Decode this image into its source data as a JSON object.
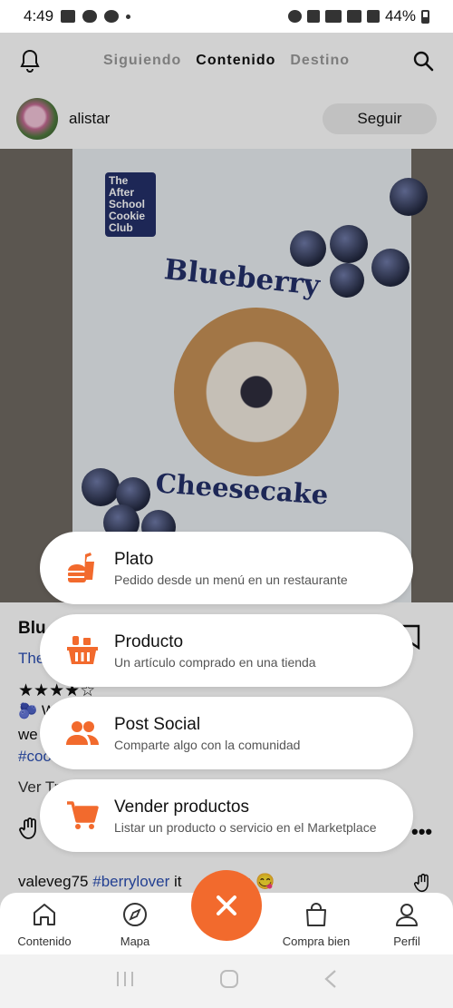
{
  "status": {
    "time": "4:49",
    "battery": "44%"
  },
  "header": {
    "tabs": [
      "Siguiendo",
      "Contenido",
      "Destino"
    ],
    "active_tab": 1
  },
  "post": {
    "username": "alistar",
    "follow_label": "Seguir",
    "poster": {
      "brand": "The After School Cookie Club",
      "title_top": "Blueberry",
      "title_bottom": "Cheesecake"
    },
    "title_fragment": "Blu",
    "link_fragment": "The",
    "stars": "★★★★☆",
    "text_fragment_1": "🫐 W",
    "text_fragment_2": "we",
    "hashtag_fragment": "#coo",
    "translate_fragment": "Ver Tr"
  },
  "comment": {
    "user": "valeveg75",
    "hashtag": "#berrylover",
    "text_a": " it ",
    "text_b": "delish 😋"
  },
  "actions": [
    {
      "title": "Plato",
      "subtitle": "Pedido desde un menú en un restaurante",
      "icon": "dish-icon"
    },
    {
      "title": "Producto",
      "subtitle": "Un artículo comprado en una tienda",
      "icon": "basket-icon"
    },
    {
      "title": "Post Social",
      "subtitle": "Comparte algo con la comunidad",
      "icon": "people-icon"
    },
    {
      "title": "Vender productos",
      "subtitle": "Listar un producto o servicio en el Marketplace",
      "icon": "cart-icon"
    }
  ],
  "nav": {
    "items": [
      "Contenido",
      "Mapa",
      "Compra bien",
      "Perfil"
    ]
  },
  "colors": {
    "accent": "#f26a2d",
    "link": "#2b4fb3",
    "poster_navy": "#24306a"
  }
}
